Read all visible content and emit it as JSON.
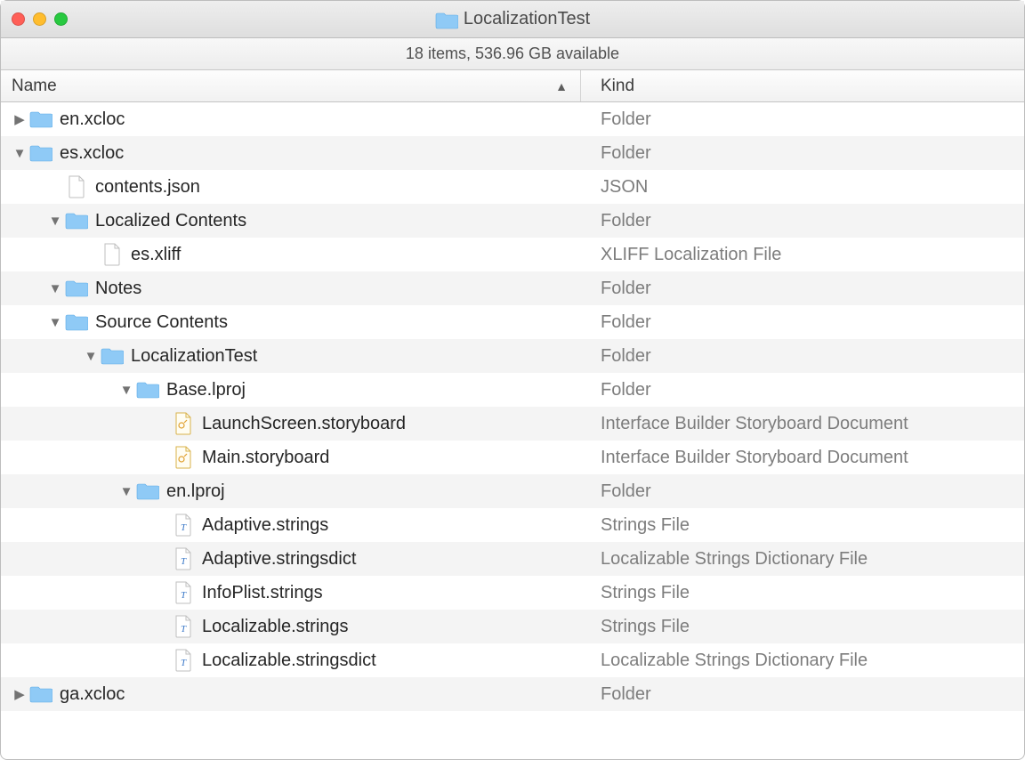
{
  "window": {
    "title": "LocalizationTest",
    "status": "18 items, 536.96 GB available"
  },
  "columns": {
    "name": "Name",
    "kind": "Kind"
  },
  "rows": [
    {
      "indent": 0,
      "disclosure": "closed",
      "icon": "folder",
      "name": "en.xcloc",
      "kind": "Folder"
    },
    {
      "indent": 0,
      "disclosure": "open",
      "icon": "folder",
      "name": "es.xcloc",
      "kind": "Folder"
    },
    {
      "indent": 1,
      "disclosure": "none",
      "icon": "file",
      "name": "contents.json",
      "kind": "JSON"
    },
    {
      "indent": 1,
      "disclosure": "open",
      "icon": "folder",
      "name": "Localized Contents",
      "kind": "Folder"
    },
    {
      "indent": 2,
      "disclosure": "none",
      "icon": "file",
      "name": "es.xliff",
      "kind": "XLIFF Localization File"
    },
    {
      "indent": 1,
      "disclosure": "open",
      "icon": "folder",
      "name": "Notes",
      "kind": "Folder"
    },
    {
      "indent": 1,
      "disclosure": "open",
      "icon": "folder",
      "name": "Source Contents",
      "kind": "Folder"
    },
    {
      "indent": 2,
      "disclosure": "open",
      "icon": "folder",
      "name": "LocalizationTest",
      "kind": "Folder"
    },
    {
      "indent": 3,
      "disclosure": "open",
      "icon": "folder",
      "name": "Base.lproj",
      "kind": "Folder"
    },
    {
      "indent": 4,
      "disclosure": "none",
      "icon": "storyboard",
      "name": "LaunchScreen.storyboard",
      "kind": "Interface Builder Storyboard Document"
    },
    {
      "indent": 4,
      "disclosure": "none",
      "icon": "storyboard",
      "name": "Main.storyboard",
      "kind": "Interface Builder Storyboard Document"
    },
    {
      "indent": 3,
      "disclosure": "open",
      "icon": "folder",
      "name": "en.lproj",
      "kind": "Folder"
    },
    {
      "indent": 4,
      "disclosure": "none",
      "icon": "strings",
      "name": "Adaptive.strings",
      "kind": "Strings File"
    },
    {
      "indent": 4,
      "disclosure": "none",
      "icon": "strings",
      "name": "Adaptive.stringsdict",
      "kind": "Localizable Strings Dictionary File"
    },
    {
      "indent": 4,
      "disclosure": "none",
      "icon": "strings",
      "name": "InfoPlist.strings",
      "kind": "Strings File"
    },
    {
      "indent": 4,
      "disclosure": "none",
      "icon": "strings",
      "name": "Localizable.strings",
      "kind": "Strings File"
    },
    {
      "indent": 4,
      "disclosure": "none",
      "icon": "strings",
      "name": "Localizable.stringsdict",
      "kind": "Localizable Strings Dictionary File"
    },
    {
      "indent": 0,
      "disclosure": "closed",
      "icon": "folder",
      "name": "ga.xcloc",
      "kind": "Folder"
    }
  ]
}
